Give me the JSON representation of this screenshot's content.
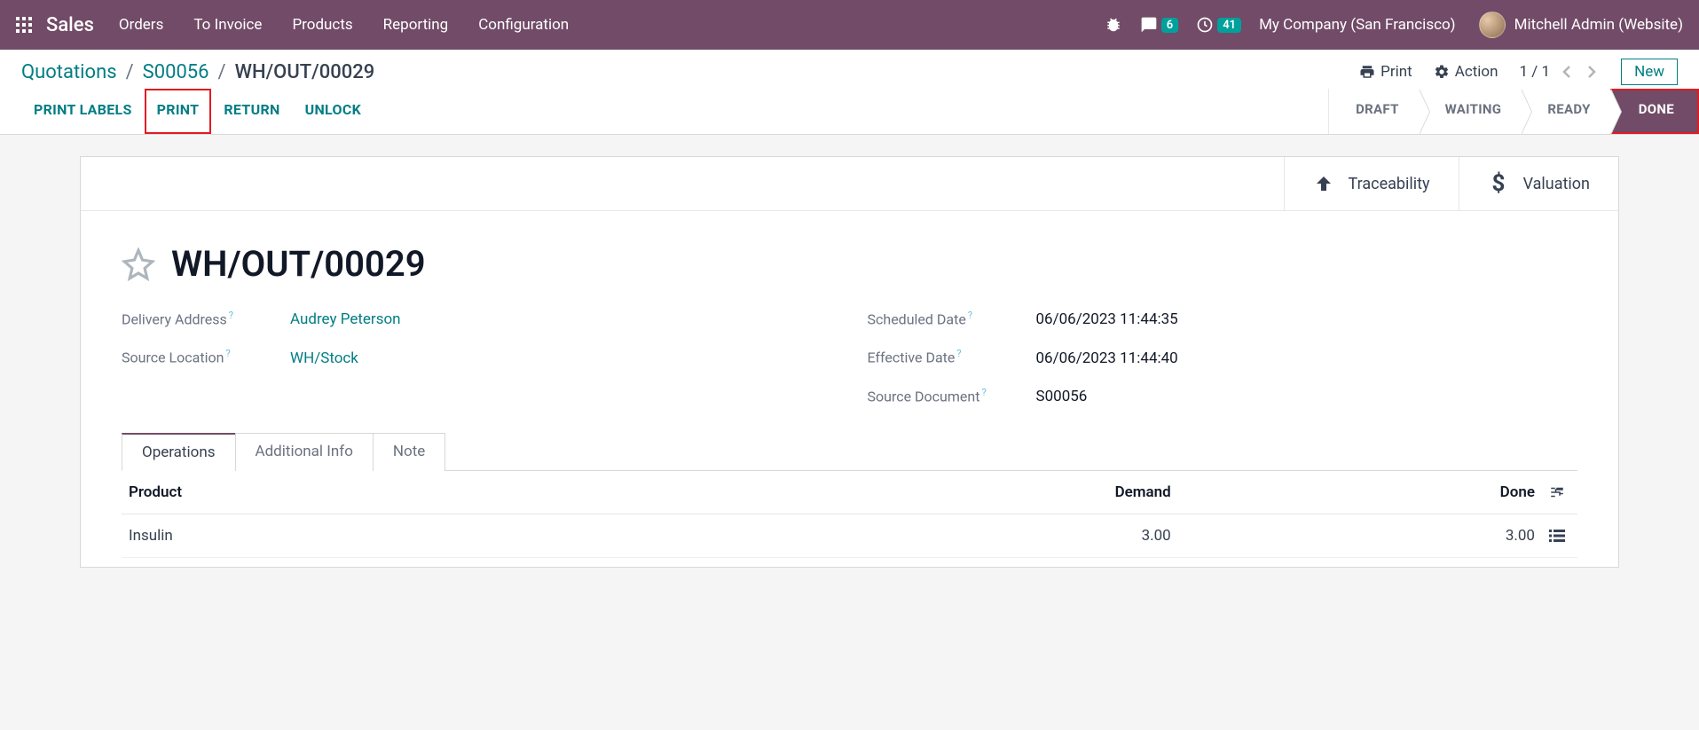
{
  "topbar": {
    "brand": "Sales",
    "menu": [
      "Orders",
      "To Invoice",
      "Products",
      "Reporting",
      "Configuration"
    ],
    "chat_badge": "6",
    "clock_badge": "41",
    "company": "My Company (San Francisco)",
    "user": "Mitchell Admin (Website)"
  },
  "breadcrumb": {
    "items": [
      "Quotations",
      "S00056"
    ],
    "current": "WH/OUT/00029"
  },
  "cp": {
    "print": "Print",
    "action": "Action",
    "pager": "1 / 1",
    "new": "New"
  },
  "status": {
    "actions": [
      "PRINT LABELS",
      "PRINT",
      "RETURN",
      "UNLOCK"
    ],
    "highlight_idx": 1,
    "stages": [
      "DRAFT",
      "WAITING",
      "READY",
      "DONE"
    ],
    "active_idx": 3
  },
  "stat_buttons": {
    "traceability": "Traceability",
    "valuation": "Valuation"
  },
  "doc": {
    "title": "WH/OUT/00029",
    "fields_left": [
      {
        "label": "Delivery Address",
        "value": "Audrey Peterson",
        "link": true
      },
      {
        "label": "Source Location",
        "value": "WH/Stock",
        "link": true
      }
    ],
    "fields_right": [
      {
        "label": "Scheduled Date",
        "value": "06/06/2023 11:44:35",
        "link": false
      },
      {
        "label": "Effective Date",
        "value": "06/06/2023 11:44:40",
        "link": false
      },
      {
        "label": "Source Document",
        "value": "S00056",
        "link": false
      }
    ]
  },
  "tabs": [
    "Operations",
    "Additional Info",
    "Note"
  ],
  "table": {
    "headers": {
      "product": "Product",
      "demand": "Demand",
      "done": "Done"
    },
    "rows": [
      {
        "product": "Insulin",
        "demand": "3.00",
        "done": "3.00"
      }
    ]
  }
}
